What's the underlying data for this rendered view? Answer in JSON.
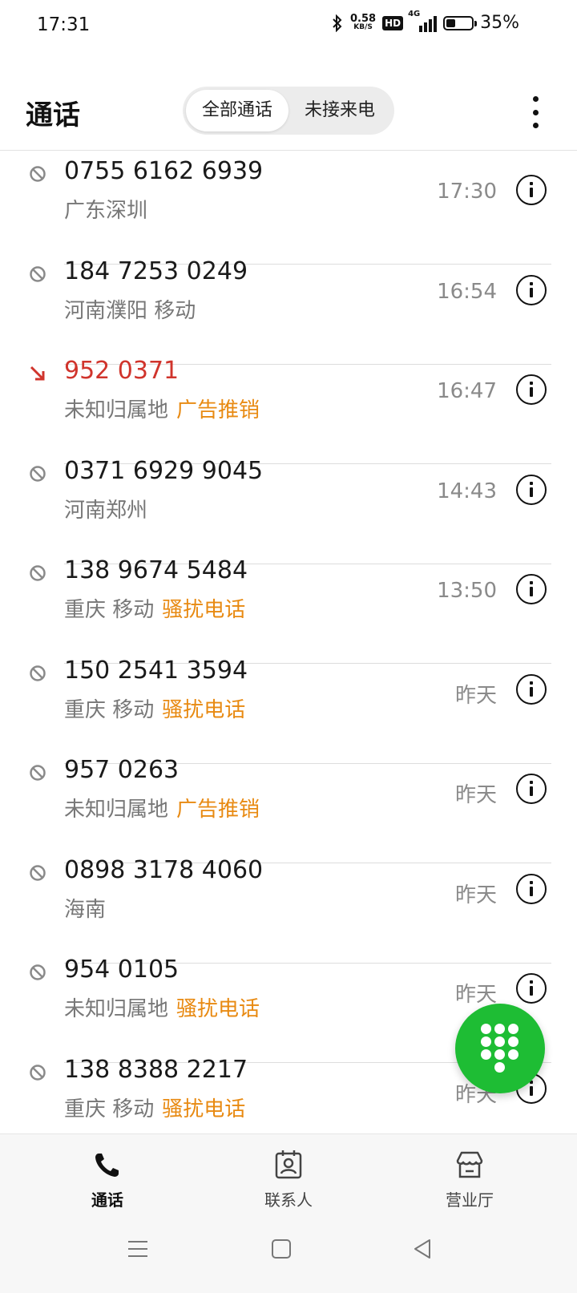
{
  "status_bar": {
    "time": "17:31",
    "net_speed_value": "0.58",
    "net_speed_unit": "KB/S",
    "hd_label": "HD",
    "network_type": "4G",
    "battery_percent": "35%",
    "battery_level": 0.35,
    "icons": [
      "bluetooth-icon",
      "hd-icon",
      "signal-icon",
      "battery-icon"
    ]
  },
  "header": {
    "title": "通话",
    "tabs": [
      {
        "label": "全部通话",
        "active": true
      },
      {
        "label": "未接来电",
        "active": false
      }
    ],
    "more_icon": "more-vertical-icon"
  },
  "calls": [
    {
      "number": "0755 6162 6939",
      "location": "广东深圳",
      "tag": "",
      "time": "17:30",
      "type": "blocked"
    },
    {
      "number": "184 7253 0249",
      "location": "河南濮阳 移动",
      "tag": "",
      "time": "16:54",
      "type": "blocked"
    },
    {
      "number": "952 0371",
      "location": "未知归属地",
      "tag": "广告推销",
      "time": "16:47",
      "type": "missed"
    },
    {
      "number": "0371 6929 9045",
      "location": "河南郑州",
      "tag": "",
      "time": "14:43",
      "type": "blocked"
    },
    {
      "number": "138 9674 5484",
      "location": "重庆 移动",
      "tag": "骚扰电话",
      "time": "13:50",
      "type": "blocked"
    },
    {
      "number": "150 2541 3594",
      "location": "重庆 移动",
      "tag": "骚扰电话",
      "time": "昨天",
      "type": "blocked"
    },
    {
      "number": "957 0263",
      "location": "未知归属地",
      "tag": "广告推销",
      "time": "昨天",
      "type": "blocked"
    },
    {
      "number": "0898 3178 4060",
      "location": "海南",
      "tag": "",
      "time": "昨天",
      "type": "blocked"
    },
    {
      "number": "954 0105",
      "location": "未知归属地",
      "tag": "骚扰电话",
      "time": "昨天",
      "type": "blocked"
    },
    {
      "number": "138 8388 2217",
      "location": "重庆 移动",
      "tag": "骚扰电话",
      "time": "昨天",
      "type": "blocked"
    }
  ],
  "fab": {
    "icon": "dialpad-icon"
  },
  "bottom_nav": {
    "items": [
      {
        "label": "通话",
        "icon": "phone-icon",
        "active": true
      },
      {
        "label": "联系人",
        "icon": "contacts-icon",
        "active": false
      },
      {
        "label": "营业厅",
        "icon": "store-icon",
        "active": false
      }
    ]
  },
  "system_nav": [
    "menu-icon",
    "home-icon",
    "back-icon"
  ],
  "colors": {
    "missed_red": "#d0342c",
    "tag_orange": "#e88a12",
    "fab_green": "#1ebd34",
    "blocked_gray": "#8a8a8a"
  }
}
